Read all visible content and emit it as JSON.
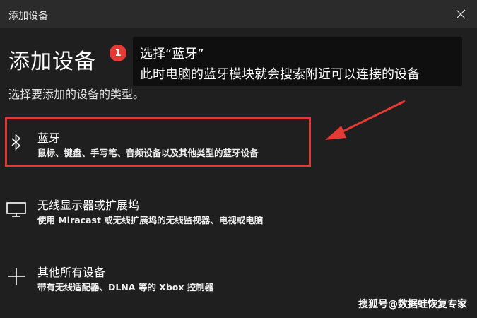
{
  "window": {
    "title": "添加设备"
  },
  "page": {
    "title": "添加设备",
    "subtitle": "选择要添加的设备的类型。"
  },
  "annotation": {
    "badge": "1",
    "line1": "选择“蓝牙”",
    "line2": "此时电脑的蓝牙模块就会搜索附近可以连接的设备",
    "highlight_color": "#e53935"
  },
  "options": [
    {
      "icon": "bluetooth-icon",
      "title": "蓝牙",
      "desc": "鼠标、键盘、手写笔、音频设备以及其他类型的蓝牙设备"
    },
    {
      "icon": "monitor-icon",
      "title": "无线显示器或扩展坞",
      "desc": "使用 Miracast 或无线扩展坞的无线监视器、电视或电脑"
    },
    {
      "icon": "plus-icon",
      "title": "其他所有设备",
      "desc": "带有无线适配器、DLNA 等的 Xbox 控制器"
    }
  ],
  "watermark": "搜狐号@数据蛙恢复专家"
}
